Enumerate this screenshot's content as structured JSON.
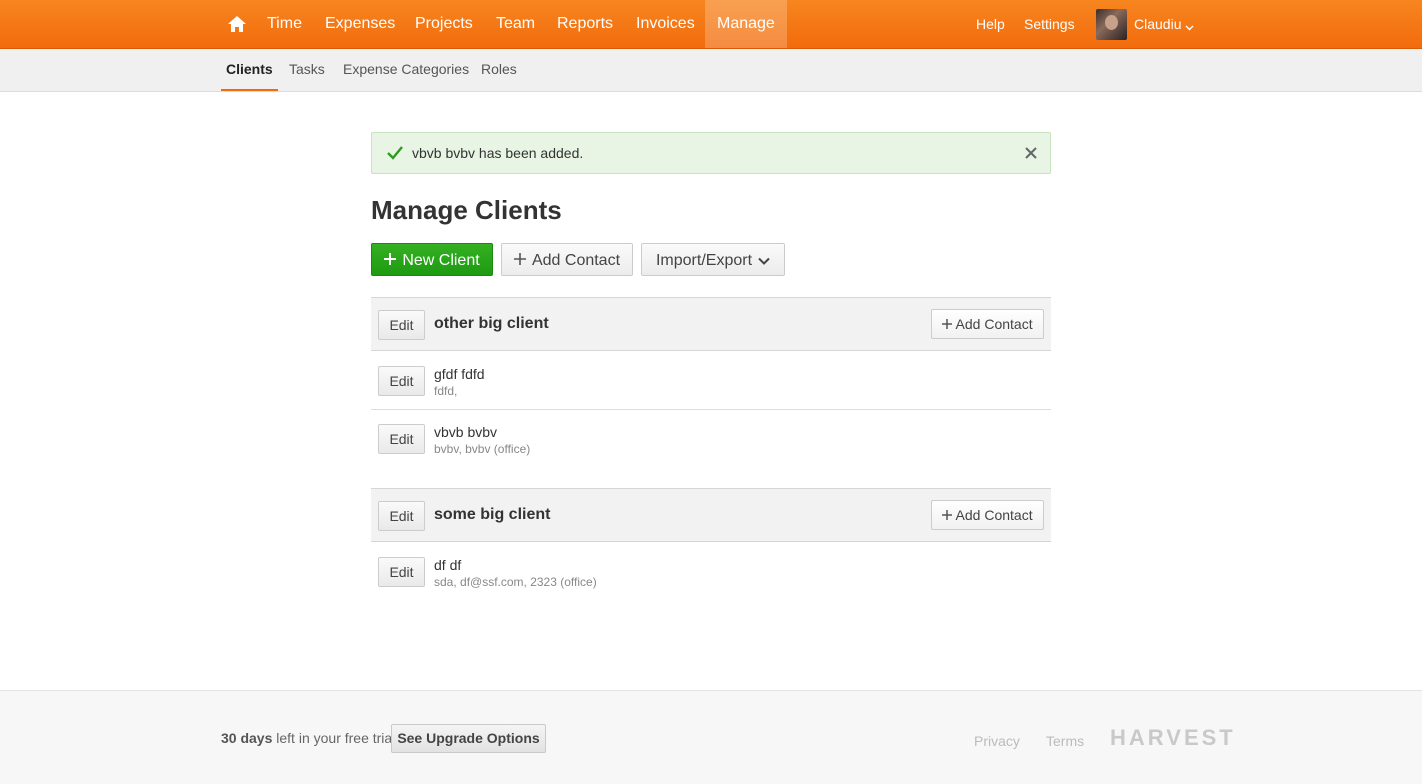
{
  "nav": {
    "items": [
      {
        "label": "Time"
      },
      {
        "label": "Expenses"
      },
      {
        "label": "Projects"
      },
      {
        "label": "Team"
      },
      {
        "label": "Reports"
      },
      {
        "label": "Invoices"
      },
      {
        "label": "Manage"
      }
    ],
    "active": "Manage",
    "help": "Help",
    "settings": "Settings",
    "user": "Claudiu",
    "home_icon": "home-icon"
  },
  "subnav": {
    "items": [
      {
        "label": "Clients"
      },
      {
        "label": "Tasks"
      },
      {
        "label": "Expense Categories"
      },
      {
        "label": "Roles"
      }
    ],
    "active": "Clients"
  },
  "flash": {
    "message": "vbvb bvbv has been added."
  },
  "page": {
    "title": "Manage Clients",
    "new_client": "New Client",
    "add_contact": "Add Contact",
    "import_export": "Import/Export"
  },
  "clients": [
    {
      "name": "other big client",
      "edit": "Edit",
      "add_contact": "Add Contact",
      "contacts": [
        {
          "name": "gfdf fdfd",
          "details": "fdfd,",
          "edit": "Edit"
        },
        {
          "name": "vbvb bvbv",
          "details": "bvbv, bvbv (office)",
          "edit": "Edit"
        }
      ]
    },
    {
      "name": "some big client",
      "edit": "Edit",
      "add_contact": "Add Contact",
      "contacts": [
        {
          "name": "df df",
          "details": "sda, df@ssf.com, 2323 (office)",
          "edit": "Edit"
        }
      ]
    }
  ],
  "footer": {
    "trial_days": "30 days",
    "trial_rest": " left in your free trial",
    "upgrade": "See Upgrade Options",
    "privacy": "Privacy",
    "terms": "Terms",
    "logo": "HARVEST"
  },
  "colors": {
    "brand": "#f26b0c",
    "primary_button": "#1e9a12",
    "flash_bg": "#e8f5e4"
  }
}
